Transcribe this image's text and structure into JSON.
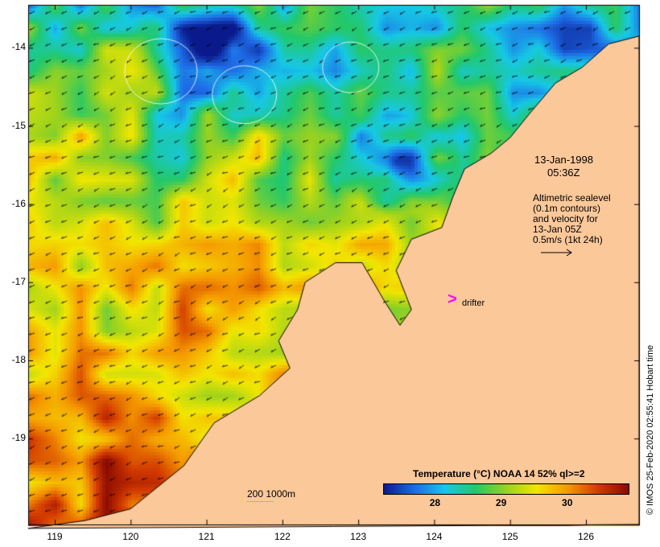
{
  "chart_data": {
    "type": "heatmap",
    "title": "Temperature (°C) NOAA 14 52% ql>=2",
    "x_ticks": [
      119,
      120,
      121,
      122,
      123,
      124,
      125,
      126
    ],
    "y_ticks": [
      -14,
      -15,
      -16,
      -17,
      -18,
      -19
    ],
    "xlim": [
      118.65,
      126.7
    ],
    "ylim": [
      -20.1,
      -13.45
    ],
    "colorbar": {
      "ticks": [
        28,
        29,
        30
      ],
      "range": [
        27.2,
        30.9
      ],
      "colors": [
        "#0a1a8c",
        "#1e6be6",
        "#16c8e6",
        "#22c86a",
        "#9ad21e",
        "#f2e600",
        "#f59a00",
        "#d23a00",
        "#8a0a00"
      ]
    },
    "land_color": "#fbc89a"
  },
  "annotations": {
    "date": "13-Jan-1998",
    "time": "05:36Z",
    "legend_lines": [
      "Altimetric sealevel",
      "(0.1m contours)",
      "and velocity for",
      "13-Jan 05Z",
      "0.5m/s (1kt 24h)"
    ],
    "drifter_label": "drifter",
    "drifter_marker": ">",
    "drifter_color": "#ff00ff",
    "bathy_label": "200  1000m",
    "bathy_color": "#66d2d2"
  },
  "stamp": "© IMOS 25-Feb-2020 02:55:41 Hobart time"
}
